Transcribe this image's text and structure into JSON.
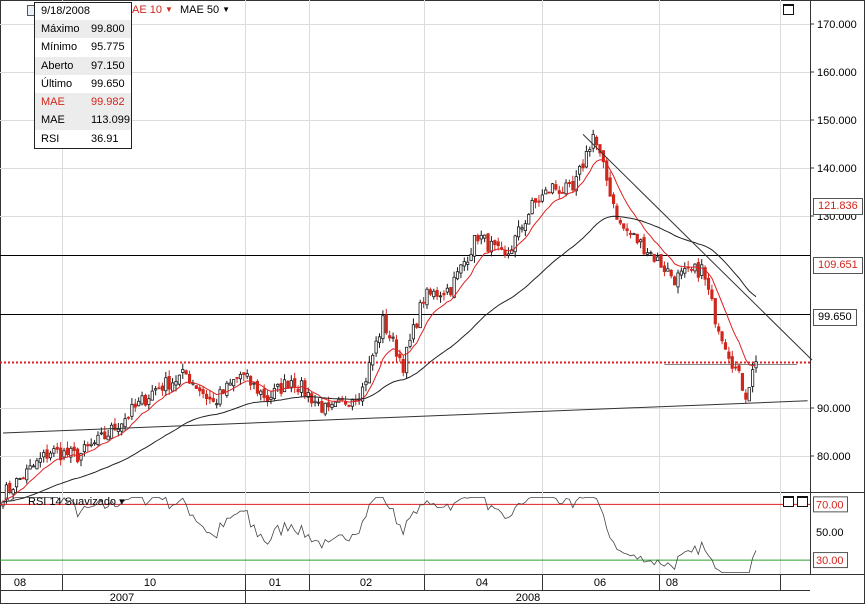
{
  "chart_data": {
    "type": "candlestick",
    "price_axis": {
      "ticks": [
        170,
        160,
        150,
        140,
        130,
        90,
        80
      ],
      "tick_labels": [
        "170.000",
        "160.000",
        "150.000",
        "140.000",
        "130.000",
        "90.000",
        "80.000"
      ],
      "range": [
        72.5,
        175
      ]
    },
    "levels": [
      {
        "name": "resistance-121836",
        "value": 121.836,
        "label": "121.836",
        "color": "#000000"
      },
      {
        "name": "resistance-109651",
        "value": 109.651,
        "label": "109.651",
        "color": "#000000"
      },
      {
        "name": "last-price",
        "value": 99.65,
        "label": "99.650",
        "color": "#e02020",
        "dotted": true
      }
    ],
    "rsi_panel": {
      "title": "RSI 14 Suavizado",
      "ticks": [
        70,
        50,
        30
      ],
      "tick_labels": [
        "70.00",
        "50.00",
        "30.00"
      ],
      "range": [
        20,
        76
      ],
      "overbought": {
        "value": 70,
        "color": "#e02020"
      },
      "oversold": {
        "value": 30,
        "color": "#2aa02a"
      }
    },
    "months": [
      "08",
      "10",
      "01",
      "02",
      "04",
      "06",
      "08"
    ],
    "years": [
      "2007",
      "2008"
    ],
    "price_series": {
      "anchors": [
        [
          0,
          72
        ],
        [
          14,
          81
        ],
        [
          22,
          80
        ],
        [
          30,
          84
        ],
        [
          45,
          94
        ],
        [
          54,
          97
        ],
        [
          62,
          91
        ],
        [
          70,
          97
        ],
        [
          78,
          92
        ],
        [
          85,
          96
        ],
        [
          96,
          89
        ],
        [
          106,
          94
        ],
        [
          112,
          108
        ],
        [
          118,
          99
        ],
        [
          124,
          113
        ],
        [
          132,
          115
        ],
        [
          140,
          126
        ],
        [
          148,
          121
        ],
        [
          156,
          132
        ],
        [
          162,
          136
        ],
        [
          168,
          135
        ],
        [
          174,
          147
        ],
        [
          182,
          128
        ],
        [
          190,
          123
        ],
        [
          198,
          117
        ],
        [
          206,
          119
        ],
        [
          210,
          109
        ],
        [
          216,
          98
        ],
        [
          219,
          93
        ],
        [
          222,
          99.65
        ]
      ],
      "last_index": 222,
      "candle_color_up": "#1a1a1a",
      "candle_color_down": "#d0261c"
    },
    "moving_averages": [
      {
        "name": "MAE 10",
        "period": 10,
        "color": "#e02020"
      },
      {
        "name": "MAE 50",
        "period": 50,
        "color": "#222222"
      }
    ],
    "trend_lines": [
      {
        "from": [
          0,
          84.8
        ],
        "to": [
          221,
          91.5
        ]
      },
      {
        "from": [
          171,
          147
        ],
        "to": [
          225,
          100
        ]
      }
    ]
  },
  "info_box": {
    "date": "9/18/2008",
    "rows": [
      {
        "label": "Máximo",
        "value": "99.800",
        "style": "shade"
      },
      {
        "label": "Mínimo",
        "value": "95.775",
        "style": ""
      },
      {
        "label": "Aberto",
        "value": "97.150",
        "style": "shade"
      },
      {
        "label": "Último",
        "value": "99.650",
        "style": ""
      },
      {
        "label": "MAE",
        "value": "99.982",
        "style": "shade red"
      },
      {
        "label": "MAE",
        "value": "113.099",
        "style": "shade"
      },
      {
        "label": "RSI",
        "value": "36.91",
        "style": ""
      }
    ]
  },
  "indicators": {
    "mae10_label": "AE 10",
    "mae50_label": "MAE 50"
  },
  "price_tags": {
    "tag_121": "121.836",
    "tag_109": "109.651",
    "tag_last": "99.650"
  },
  "colors": {
    "red": "#d0261c",
    "green": "#2aa02a",
    "grid": "#dcdcdc"
  }
}
